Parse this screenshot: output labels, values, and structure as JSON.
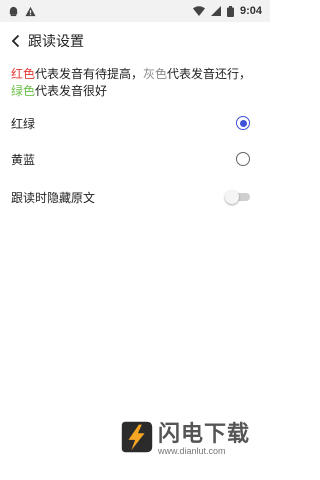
{
  "status_bar": {
    "time": "9:04",
    "icons": [
      "android-icon",
      "warning-icon",
      "wifi-icon",
      "signal-icon",
      "battery-icon"
    ]
  },
  "app_bar": {
    "title": "跟读设置",
    "back_icon": "chevron-left-icon"
  },
  "description": {
    "red_word": "红色",
    "red_text": "代表发音有待提高，",
    "gray_word": "灰色",
    "gray_text": "代表发音还行，",
    "green_word": "绿色",
    "green_text": "代表发音很好",
    "colors": {
      "red": "#e53935",
      "gray": "#8a8a8a",
      "green": "#6cc04a"
    }
  },
  "options": [
    {
      "label": "红绿",
      "selected": true
    },
    {
      "label": "黄蓝",
      "selected": false
    }
  ],
  "toggle_row": {
    "label": "跟读时隐藏原文",
    "enabled": false
  },
  "watermark": {
    "title": "闪电下载",
    "url": "www.dianlut.com"
  },
  "colors": {
    "accent": "#3f51d6",
    "text": "#222222",
    "background": "#ffffff"
  }
}
